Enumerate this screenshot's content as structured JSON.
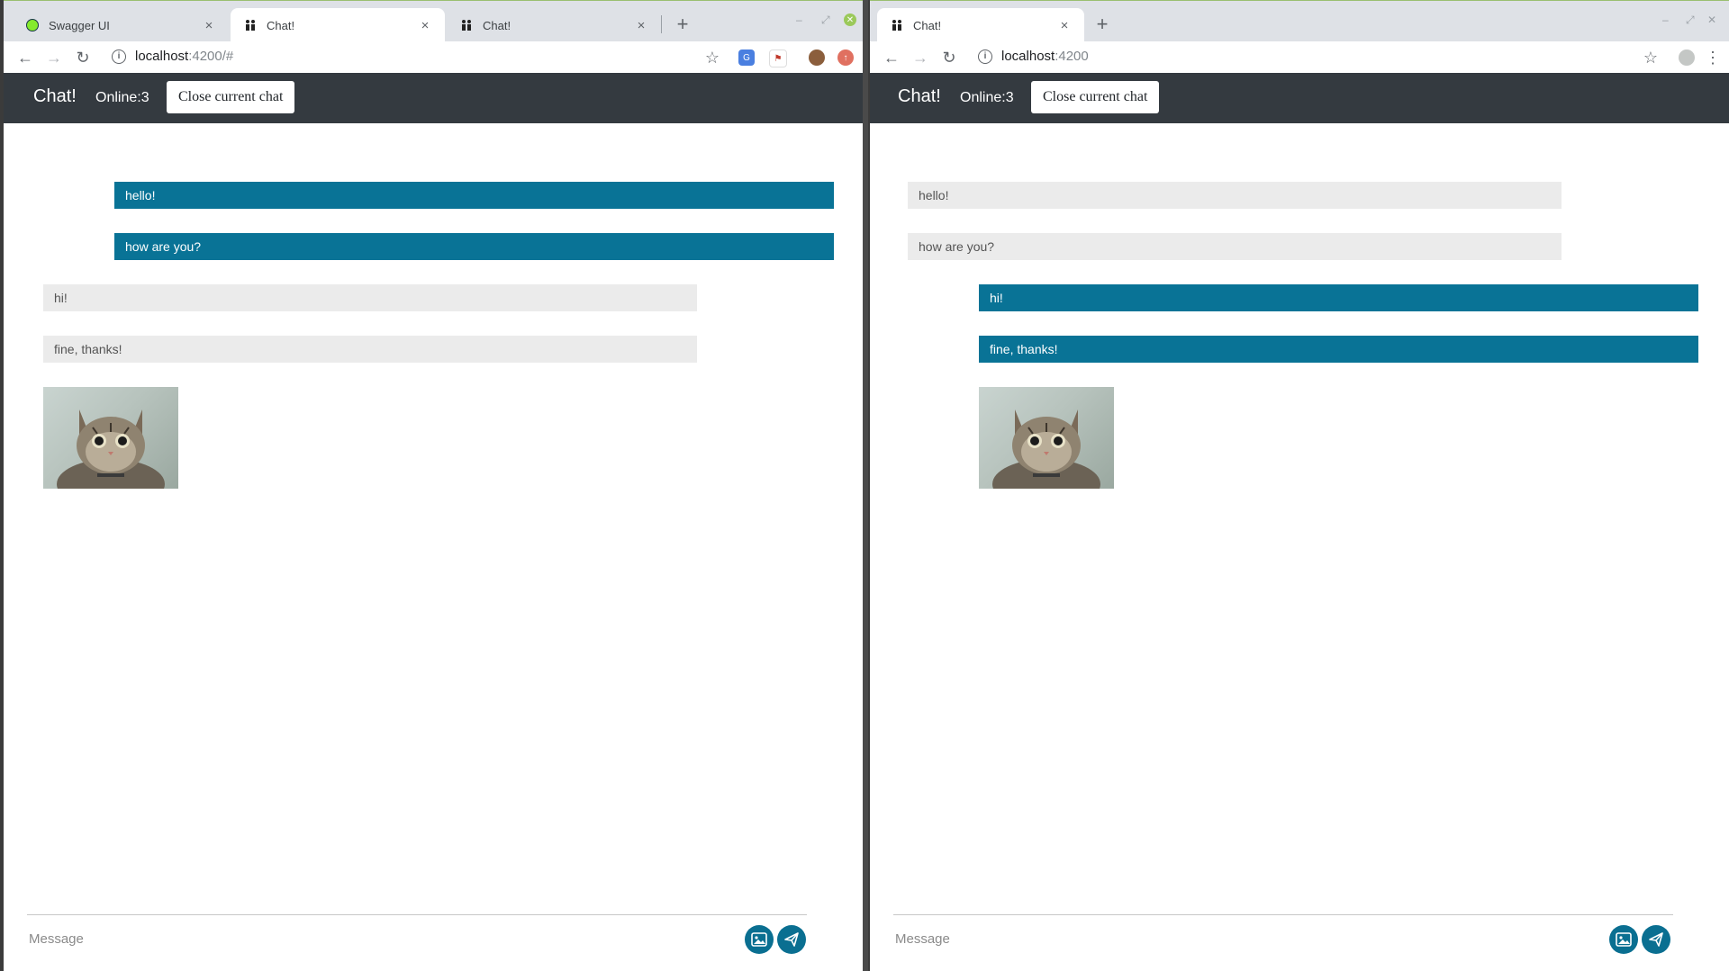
{
  "left_window": {
    "tabs": [
      {
        "title": "Swagger UI",
        "icon": "swagger-icon",
        "close": "×"
      },
      {
        "title": "Chat!",
        "icon": "people-icon",
        "close": "×"
      },
      {
        "title": "Chat!",
        "icon": "people-icon",
        "close": "×"
      }
    ],
    "new_tab": "+",
    "url_host": "localhost",
    "url_path": ":4200/#"
  },
  "right_window": {
    "tabs": [
      {
        "title": "Chat!",
        "icon": "people-icon",
        "close": "×"
      }
    ],
    "new_tab": "+",
    "url_host": "localhost",
    "url_path": ":4200"
  },
  "app": {
    "brand": "Chat!",
    "online": "Online:3",
    "close_chat": "Close current chat",
    "message_placeholder": "Message"
  },
  "messages": [
    {
      "text": "hello!",
      "author": "left"
    },
    {
      "text": "how are you?",
      "author": "left"
    },
    {
      "text": "hi!",
      "author": "right"
    },
    {
      "text": "fine, thanks!",
      "author": "right"
    }
  ],
  "colors": {
    "accent": "#097396",
    "navbar": "#343a40",
    "incoming_bubble": "#ebebeb"
  }
}
